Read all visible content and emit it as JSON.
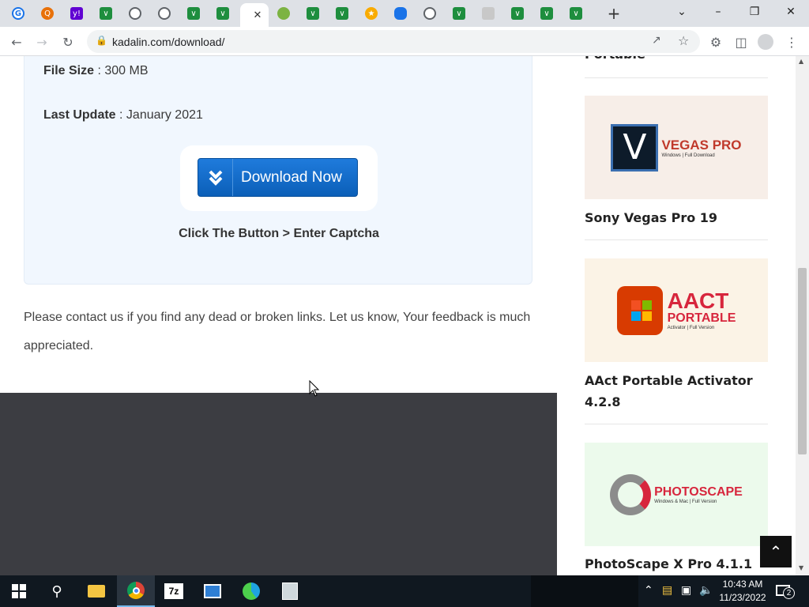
{
  "browser": {
    "url": "kadalin.com/download/",
    "tabs": [
      {
        "icon": "google-icon"
      },
      {
        "icon": "orange-search-icon"
      },
      {
        "icon": "yahoo-icon"
      },
      {
        "icon": "kadalin-icon"
      },
      {
        "icon": "globe-icon"
      },
      {
        "icon": "globe-icon"
      },
      {
        "icon": "kadalin-icon"
      },
      {
        "icon": "kadalin-icon"
      },
      {
        "icon": "active-tab"
      },
      {
        "icon": "leaf-icon"
      },
      {
        "icon": "kadalin-icon"
      },
      {
        "icon": "kadalin-icon"
      },
      {
        "icon": "star-icon"
      },
      {
        "icon": "cloud-icon"
      },
      {
        "icon": "globe-icon"
      },
      {
        "icon": "kadalin-icon"
      },
      {
        "icon": "text-icon"
      },
      {
        "icon": "kadalin-icon"
      },
      {
        "icon": "kadalin-icon"
      },
      {
        "icon": "kadalin-icon"
      }
    ]
  },
  "download": {
    "file_size_label": "File Size",
    "file_size_value": ": 300 MB",
    "last_update_label": "Last Update",
    "last_update_value": ": January 2021",
    "button_label": "Download Now",
    "hint": "Click The Button > Enter Captcha"
  },
  "contact_text": "Please contact us if you find any dead or broken links. Let us know, Your feedback is much appreciated.",
  "sidebar": {
    "cut_title": "Portable",
    "items": [
      {
        "title": "Sony Vegas Pro 19",
        "thumb_text": "VEGAS PRO",
        "thumb_sub": "Windows | Full Download",
        "thumb_bg": "#f7eee8",
        "thumb_color": "#c0392b",
        "thumb_mark": "V"
      },
      {
        "title": "AAct Portable Activator 4.2.8",
        "thumb_text": "AACT",
        "thumb_text2": "PORTABLE",
        "thumb_sub": "Activator | Full Version",
        "thumb_bg": "#fbf3e6",
        "thumb_color": "#d7263d"
      },
      {
        "title": "PhotoScape X Pro 4.1.1",
        "thumb_text": "PHOTOSCAPE",
        "thumb_sub": "Windows & Mac | Full Version",
        "thumb_bg": "#ecfaec",
        "thumb_color": "#d7263d"
      }
    ]
  },
  "taskbar": {
    "time": "10:43 AM",
    "date": "11/23/2022",
    "notification_count": "2"
  }
}
